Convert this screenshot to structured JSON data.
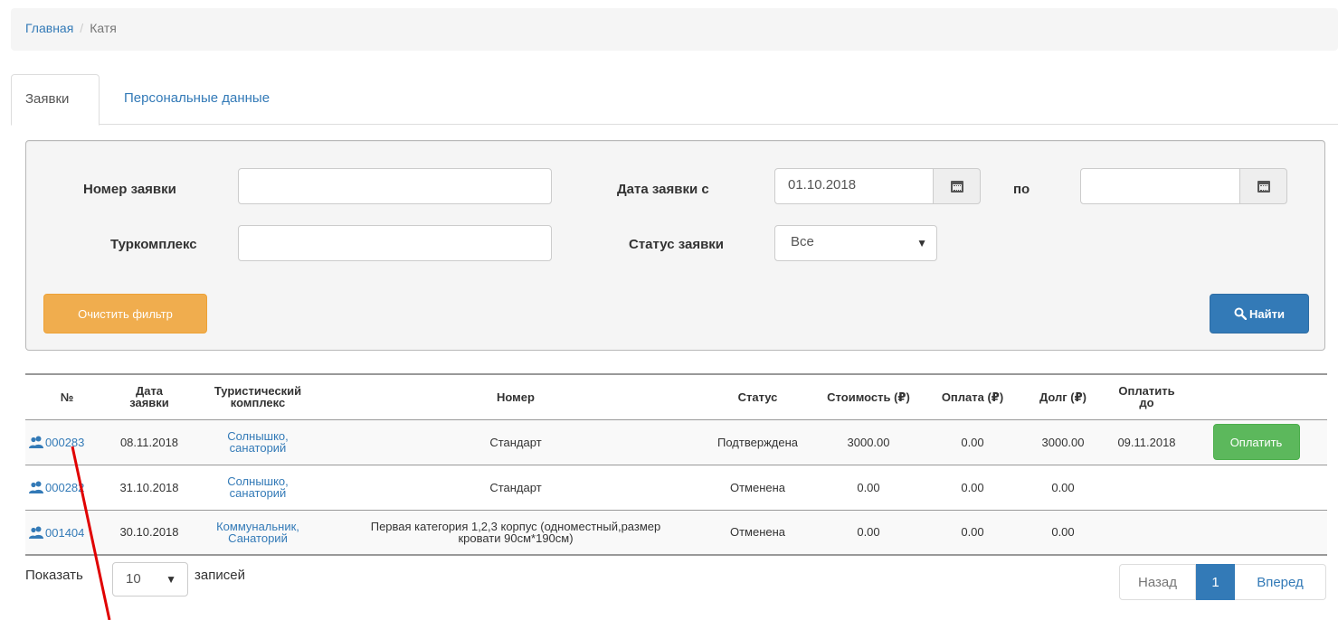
{
  "breadcrumb": {
    "home": "Главная",
    "current": "Катя",
    "separator": "/"
  },
  "tabs": [
    {
      "label": "Заявки"
    },
    {
      "label": "Персональные данные"
    }
  ],
  "filter": {
    "order_number_label": "Номер заявки",
    "order_number_value": "",
    "date_from_label": "Дата заявки с",
    "date_from_value": "01.10.2018",
    "date_to_label": "по",
    "date_to_value": "",
    "complex_label": "Туркомплекс",
    "complex_value": "",
    "status_label": "Статус заявки",
    "status_value": "Все",
    "clear_button": "Очистить фильтр",
    "search_button": "Найти"
  },
  "table": {
    "headers": {
      "num": "№",
      "date_l1": "Дата",
      "date_l2": "заявки",
      "complex_l1": "Туристический",
      "complex_l2": "комплекс",
      "room": "Номер",
      "status": "Статус",
      "cost": "Стоимость (₽)",
      "paid": "Оплата (₽)",
      "debt": "Долг (₽)",
      "payby_l1": "Оплатить",
      "payby_l2": "до"
    },
    "rows": [
      {
        "num": "000283",
        "date": "08.11.2018",
        "complex_l1": "Солнышко,",
        "complex_l2": "санаторий",
        "room_l1": "Стандарт",
        "room_l2": "",
        "status": "Подтверждена",
        "cost": "3000.00",
        "paid": "0.00",
        "debt": "3000.00",
        "pay_by": "09.11.2018",
        "pay_button": "Оплатить"
      },
      {
        "num": "000282",
        "date": "31.10.2018",
        "complex_l1": "Солнышко,",
        "complex_l2": "санаторий",
        "room_l1": "Стандарт",
        "room_l2": "",
        "status": "Отменена",
        "cost": "0.00",
        "paid": "0.00",
        "debt": "0.00",
        "pay_by": "",
        "pay_button": ""
      },
      {
        "num": "001404",
        "date": "30.10.2018",
        "complex_l1": "Коммунальник,",
        "complex_l2": "Санаторий",
        "room_l1": "Первая категория 1,2,3 корпус (одноместный,размер",
        "room_l2": "кровати 90см*190см)",
        "status": "Отменена",
        "cost": "0.00",
        "paid": "0.00",
        "debt": "0.00",
        "pay_by": "",
        "pay_button": ""
      }
    ]
  },
  "paging": {
    "show_label": "Показать",
    "page_size": "10",
    "entries_label": "записей",
    "prev": "Назад",
    "current_page": "1",
    "next": "Вперед"
  },
  "icons": {
    "calendar": "calendar-icon",
    "search": "search-icon",
    "users": "users-icon",
    "caret": "caret-down-icon"
  },
  "colors": {
    "link": "#337ab7",
    "warning": "#f0ad4e",
    "primary": "#337ab7",
    "success": "#5cb85c",
    "annotation": "#e00000"
  }
}
